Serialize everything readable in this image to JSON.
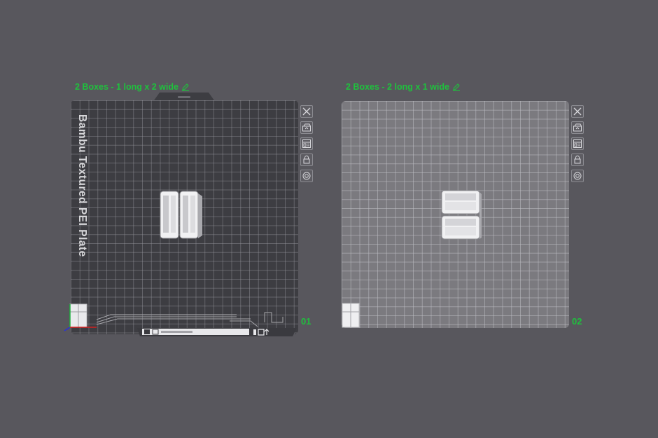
{
  "plates": [
    {
      "title": "2 Boxes - 1 long x 2 wide",
      "number": "01",
      "bed_label": "Bambu Textured PEI Plate",
      "selected": true
    },
    {
      "title": "2 Boxes - 2 long x 1 wide",
      "number": "02",
      "selected": false
    }
  ],
  "toolbar_icons": [
    "close-icon",
    "auto-orient-icon",
    "arrange-icon",
    "lock-icon",
    "settings-icon"
  ],
  "colors": {
    "accent": "#1fc03d",
    "background": "#58575d",
    "bed_dark": "#3d3d42",
    "bed_light": "#7b7a7f"
  }
}
